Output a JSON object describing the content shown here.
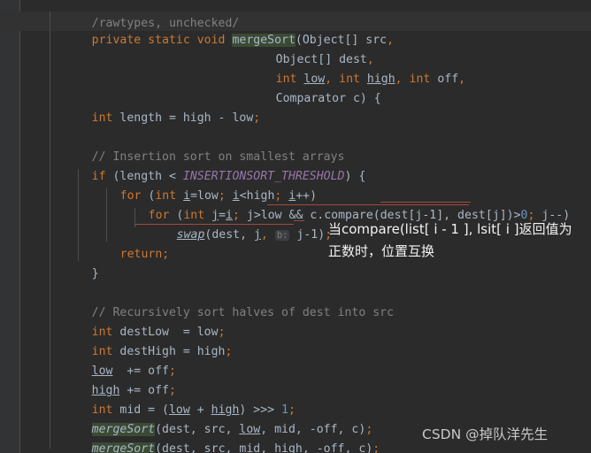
{
  "editor": {
    "theme": "darcula",
    "background_color": "#2b2b2b",
    "gutter_color": "#313335",
    "caret_line_color": "#323232",
    "default_text_color": "#a9b7c6",
    "keyword_color": "#cc7832",
    "comment_color": "#808080",
    "number_color": "#6897bb",
    "constant_color": "#9876aa",
    "occurrence_highlight_color": "#3a4a34",
    "error_underline_color": "#a24a42",
    "inlay_hint_color": "#7a7a7a"
  },
  "code": {
    "line_01_clipped": "/rawtypes, unchecked/",
    "line_02_a": "private static void ",
    "line_02_b": "mergeSort",
    "line_02_c": "(Object[] src",
    "line_02_d": ",",
    "line_03_a": "Object[] dest",
    "line_03_b": ",",
    "line_04_a": "int ",
    "line_04_b": "low",
    "line_04_c": ", ",
    "line_04_d": "int ",
    "line_04_e": "high",
    "line_04_f": ", ",
    "line_04_g": "int ",
    "line_04_h": "off",
    "line_04_i": ",",
    "line_05_a": "Comparator c) {",
    "line_06_a": "int ",
    "line_06_b": "length = high - low",
    "line_06_c": ";",
    "line_08_comment": "// Insertion sort on smallest arrays",
    "line_09_a": "if ",
    "line_09_b": "(length < ",
    "line_09_c": "INSERTIONSORT_THRESHOLD",
    "line_09_d": ") {",
    "line_10_a": "for ",
    "line_10_b": "(",
    "line_10_c": "int ",
    "line_10_d": "i",
    "line_10_e": "=low",
    "line_10_f": "; ",
    "line_10_g": "i",
    "line_10_h": "<high",
    "line_10_i": "; ",
    "line_10_j": "i",
    "line_10_k": "++)",
    "line_11_a": "for ",
    "line_11_b": "(",
    "line_11_c": "int ",
    "line_11_d": "j",
    "line_11_e": "=",
    "line_11_f": "i",
    "line_11_g": "; ",
    "line_11_h": "j>low && c.compare(dest[j-1], dest[j])>",
    "line_11_i": "0",
    "line_11_j": "; ",
    "line_11_k": "j--)",
    "line_12_a": "swap",
    "line_12_b": "(dest, ",
    "line_12_c": "j",
    "line_12_d": ", ",
    "line_12_hint": "b:",
    "line_12_e": " j-1)",
    "line_12_f": ";",
    "line_13_a": "return",
    "line_13_b": ";",
    "line_14_a": "}",
    "line_16_comment": "// Recursively sort halves of dest into src",
    "line_17_a": "int ",
    "line_17_b": "destLow  = low",
    "line_17_c": ";",
    "line_18_a": "int ",
    "line_18_b": "destHigh = high",
    "line_18_c": ";",
    "line_19_a": "low",
    "line_19_b": "  += off",
    "line_19_c": ";",
    "line_20_a": "high",
    "line_20_b": " += off",
    "line_20_c": ";",
    "line_21_a": "int ",
    "line_21_b": "mid = (",
    "line_21_c": "low",
    "line_21_d": " + ",
    "line_21_e": "high",
    "line_21_f": ") >>> ",
    "line_21_g": "1",
    "line_21_h": ";",
    "line_22_a": "mergeSort",
    "line_22_b": "(dest, src, ",
    "line_22_c": "low",
    "line_22_d": ", mid, -off, c)",
    "line_22_e": ";",
    "line_23_a": "mergeSort",
    "line_23_b": "(dest, src, mid, ",
    "line_23_c": "high",
    "line_23_d": ", -off, c)",
    "line_23_e": ";"
  },
  "annotation": {
    "text": "当compare(list[ i - 1 ], lsit[ i ]返回值为正数时，位置互换",
    "color": "#f2f2f2"
  },
  "watermark": {
    "text": "CSDN @掉队洋先生"
  }
}
